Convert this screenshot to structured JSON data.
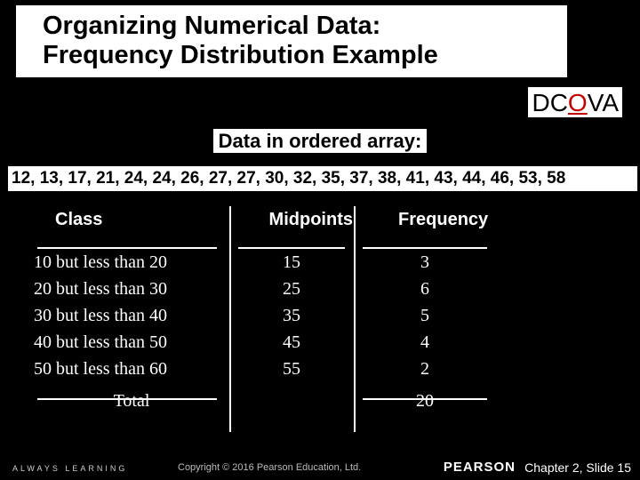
{
  "title_line1": "Organizing Numerical Data:",
  "title_line2": "Frequency Distribution Example",
  "dcova": {
    "d": "D",
    "c": "C",
    "o": "O",
    "v": "V",
    "a": "A"
  },
  "ordered_label": "Data in ordered array:",
  "ordered_array": "12, 13, 17, 21, 24, 24, 26, 27, 27, 30, 32, 35, 37, 38, 41, 43, 44, 46, 53, 58",
  "headers": {
    "class": "Class",
    "mid": "Midpoints",
    "freq": "Frequency"
  },
  "rows": [
    {
      "class": "10 but less than 20",
      "mid": "15",
      "freq": "3"
    },
    {
      "class": "20 but less than 30",
      "mid": "25",
      "freq": "6"
    },
    {
      "class": "30 but less than 40",
      "mid": "35",
      "freq": "5"
    },
    {
      "class": "40 but less than 50",
      "mid": "45",
      "freq": "4"
    },
    {
      "class": "50 but less than 60",
      "mid": "55",
      "freq": "2"
    }
  ],
  "total_label": "Total",
  "total_freq": "20",
  "footer": {
    "always": "ALWAYS LEARNING",
    "copyright": "Copyright © 2016 Pearson Education, Ltd.",
    "pearson": "PEARSON",
    "chapter": "Chapter 2, Slide 15"
  },
  "chart_data": {
    "type": "table",
    "title": "Frequency Distribution",
    "columns": [
      "Class",
      "Midpoints",
      "Frequency"
    ],
    "rows": [
      [
        "10 but less than 20",
        15,
        3
      ],
      [
        "20 but less than 30",
        25,
        6
      ],
      [
        "30 but less than 40",
        35,
        5
      ],
      [
        "40 but less than 50",
        45,
        4
      ],
      [
        "50 but less than 60",
        55,
        2
      ]
    ],
    "total_frequency": 20,
    "ordered_values": [
      12,
      13,
      17,
      21,
      24,
      24,
      26,
      27,
      27,
      30,
      32,
      35,
      37,
      38,
      41,
      43,
      44,
      46,
      53,
      58
    ]
  }
}
